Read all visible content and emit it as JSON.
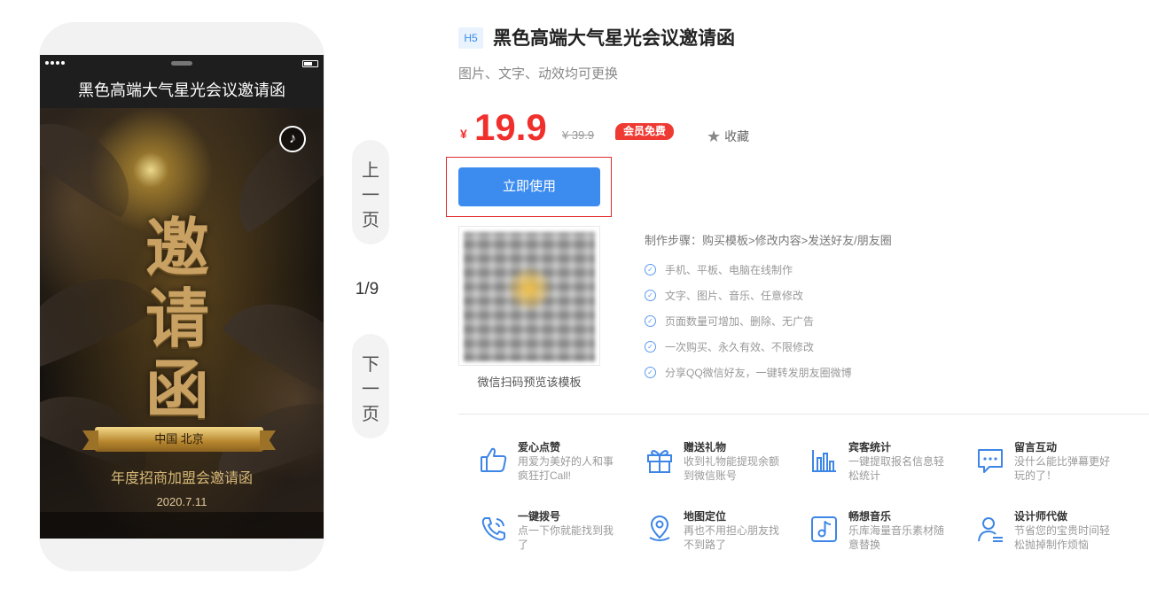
{
  "phone": {
    "title": "黑色高端大气星光会议邀请函",
    "poster": {
      "chars": [
        "邀",
        "请",
        "函"
      ],
      "ribbon_text": "中国   北京",
      "subtitle": "年度招商加盟会邀请函",
      "date": "2020.7.11"
    }
  },
  "pager": {
    "prev_chars": [
      "上",
      "一",
      "页"
    ],
    "next_chars": [
      "下",
      "一",
      "页"
    ],
    "count": "1/9"
  },
  "product": {
    "badge": "H5",
    "title": "黑色高端大气星光会议邀请函",
    "subtitle": "图片、文字、动效均可更换",
    "currency": "¥",
    "price": "19.9",
    "old_price": "¥ 39.9",
    "vip_badge": "会员免费",
    "favorite_label": "收藏",
    "use_button": "立即使用",
    "qr_caption": "微信扫码预览该模板",
    "steps_title": "制作步骤：购买模板>修改内容>发送好友/朋友圈",
    "features_list": [
      "手机、平板、电脑在线制作",
      "文字、图片、音乐、任意修改",
      "页面数量可增加、删除、无广告",
      "一次购买、永久有效、不限修改",
      "分享QQ微信好友，一键转发朋友圈微博"
    ],
    "feature_grid": [
      {
        "title": "爱心点赞",
        "desc": "用爱为美好的人和事疯狂打Call!",
        "icon": "thumbs-up-icon"
      },
      {
        "title": "赠送礼物",
        "desc": "收到礼物能提现余额到微信账号",
        "icon": "gift-icon"
      },
      {
        "title": "宾客统计",
        "desc": "一键提取报名信息轻松统计",
        "icon": "bar-chart-icon"
      },
      {
        "title": "留言互动",
        "desc": "没什么能比弹幕更好玩的了！",
        "icon": "comment-icon"
      },
      {
        "title": "一键拨号",
        "desc": "点一下你就能找到我了",
        "icon": "phone-icon"
      },
      {
        "title": "地图定位",
        "desc": "再也不用担心朋友找不到路了",
        "icon": "map-pin-icon"
      },
      {
        "title": "畅想音乐",
        "desc": "乐库海量音乐素材随意替换",
        "icon": "music-icon"
      },
      {
        "title": "设计师代做",
        "desc": "节省您的宝贵时间轻松抛掉制作烦恼",
        "icon": "designer-icon"
      }
    ]
  },
  "colors": {
    "accent_blue": "#3c8cf0",
    "price_red": "#f0302c",
    "highlight_frame": "#e22a2a",
    "poster_gold": "#c9a263"
  }
}
